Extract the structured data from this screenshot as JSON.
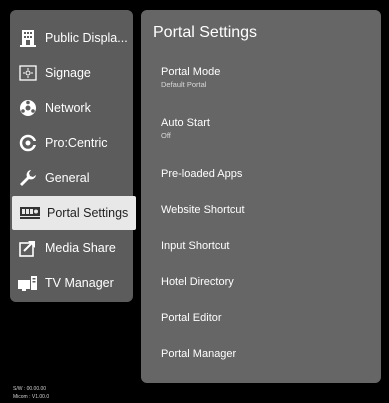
{
  "left_menu": {
    "items": [
      {
        "label": "Public Displa...",
        "icon": "building-icon"
      },
      {
        "label": "Signage",
        "icon": "signage-icon"
      },
      {
        "label": "Network",
        "icon": "network-icon"
      },
      {
        "label": "Pro:Centric",
        "icon": "procentric-icon"
      },
      {
        "label": "General",
        "icon": "wrench-icon"
      },
      {
        "label": "Portal Settings",
        "icon": "portal-icon"
      },
      {
        "label": "Media Share",
        "icon": "media-share-icon"
      },
      {
        "label": "TV Manager",
        "icon": "tv-manager-icon"
      }
    ],
    "selected_label": "Portal Settings"
  },
  "panel": {
    "title": "Portal Settings",
    "settings": [
      {
        "label": "Portal Mode",
        "value": "Default Portal"
      },
      {
        "label": "Auto Start",
        "value": "Off"
      },
      {
        "label": "Pre-loaded Apps"
      },
      {
        "label": "Website Shortcut"
      },
      {
        "label": "Input Shortcut"
      },
      {
        "label": "Hotel Directory"
      },
      {
        "label": "Portal Editor"
      },
      {
        "label": "Portal Manager"
      }
    ]
  },
  "footer": {
    "sw_version": "S/W : 00.00.00",
    "micom_version": "Micom : V1.00.0"
  },
  "colors": {
    "background": "#000000",
    "menu_bg": "#5c5c5c",
    "panel_bg": "#666666",
    "selected_bg": "#e8e8e8"
  }
}
